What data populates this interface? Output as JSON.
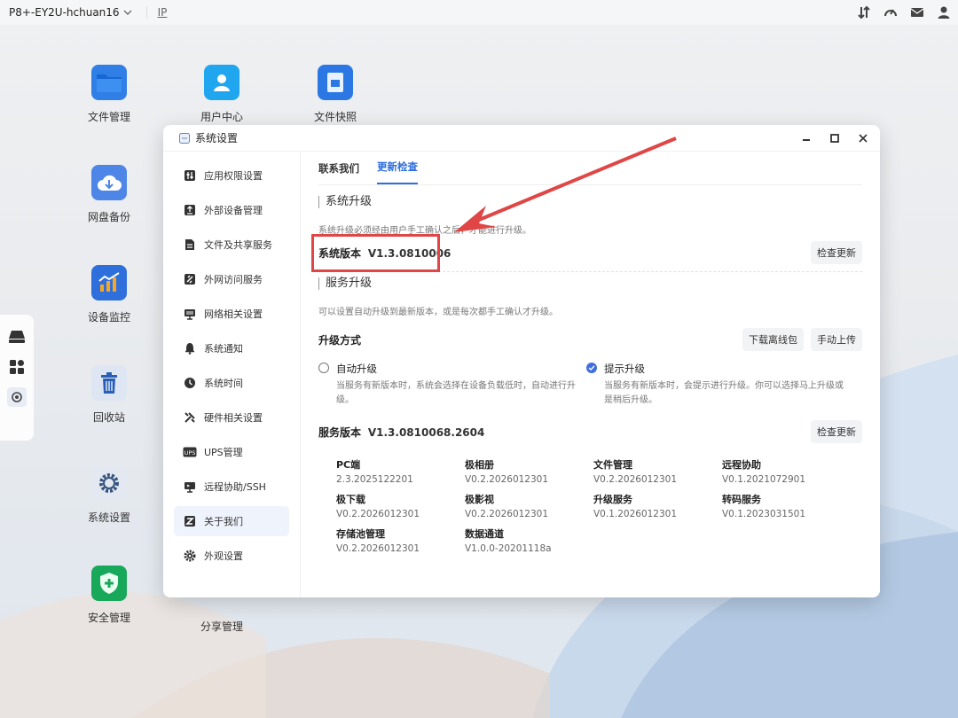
{
  "topbar": {
    "device_name": "P8+-EY2U-hchuan16",
    "ip_label": "IP"
  },
  "desktop": {
    "apps": [
      {
        "label": "文件管理"
      },
      {
        "label": "用户中心"
      },
      {
        "label": "文件快照"
      },
      {
        "label": "网盘备份"
      },
      {
        "label": "设备监控"
      },
      {
        "label": "回收站"
      },
      {
        "label": "系统设置"
      },
      {
        "label": "安全管理"
      },
      {
        "label": "分享管理"
      }
    ]
  },
  "window": {
    "title": "系统设置",
    "sidebar": [
      {
        "label": "应用权限设置",
        "icon": "sliders-icon"
      },
      {
        "label": "外部设备管理",
        "icon": "external-device-icon"
      },
      {
        "label": "文件及共享服务",
        "icon": "file-share-icon"
      },
      {
        "label": "外网访问服务",
        "icon": "link-icon"
      },
      {
        "label": "网络相关设置",
        "icon": "network-icon"
      },
      {
        "label": "系统通知",
        "icon": "bell-icon"
      },
      {
        "label": "系统时间",
        "icon": "clock-icon"
      },
      {
        "label": "硬件相关设置",
        "icon": "tools-icon"
      },
      {
        "label": "UPS管理",
        "icon": "ups-icon"
      },
      {
        "label": "远程协助/SSH",
        "icon": "remote-icon"
      },
      {
        "label": "关于我们",
        "icon": "about-icon"
      },
      {
        "label": "外观设置",
        "icon": "gear-icon"
      }
    ],
    "active_sidebar": 10,
    "tabs": [
      {
        "label": "联系我们"
      },
      {
        "label": "更新检查"
      }
    ],
    "active_tab": 1,
    "system_upgrade": {
      "title": "系统升级",
      "hint": "系统升级必须经由用户手工确认之后，才能进行升级。",
      "version_label": "系统版本",
      "version_value": "V1.3.0810006",
      "check_button": "检查更新"
    },
    "service_upgrade": {
      "title": "服务升级",
      "hint": "可以设置自动升级到最新版本，或是每次都手工确认才升级。",
      "mode_label": "升级方式",
      "download_offline": "下载离线包",
      "manual_upload": "手动上传",
      "options": [
        {
          "title": "自动升级",
          "desc": "当服务有新版本时，系统会选择在设备负载低时，自动进行升级。",
          "checked": false
        },
        {
          "title": "提示升级",
          "desc": "当服务有新版本时，会提示进行升级。你可以选择马上升级或是稍后升级。",
          "checked": true
        }
      ],
      "version_label": "服务版本",
      "version_value": "V1.3.0810068.2604",
      "check_button": "检查更新",
      "services": [
        {
          "name": "PC端",
          "version": "2.3.2025122201"
        },
        {
          "name": "极相册",
          "version": "V0.2.2026012301"
        },
        {
          "name": "文件管理",
          "version": "V0.2.2026012301"
        },
        {
          "name": "远程协助",
          "version": "V0.1.2021072901"
        },
        {
          "name": "极下载",
          "version": "V0.2.2026012301"
        },
        {
          "name": "极影视",
          "version": "V0.2.2026012301"
        },
        {
          "name": "升级服务",
          "version": "V0.1.2026012301"
        },
        {
          "name": "转码服务",
          "version": "V0.1.2023031501"
        },
        {
          "name": "存储池管理",
          "version": "V0.2.2026012301"
        },
        {
          "name": "数据通道",
          "version": "V1.0.0-20201118a"
        }
      ]
    }
  }
}
